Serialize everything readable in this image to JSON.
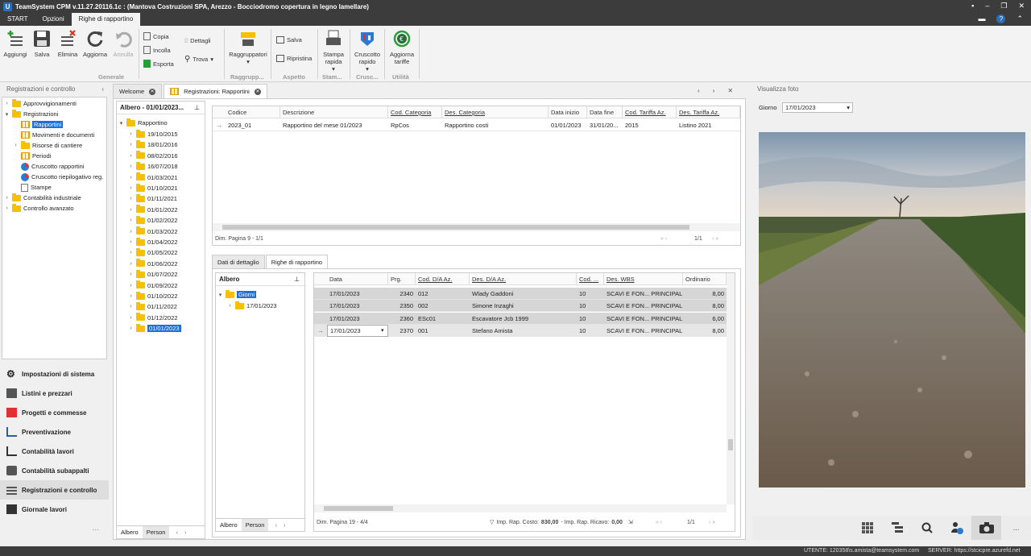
{
  "window": {
    "title": "TeamSystem CPM v.11.27.20116.1c : (Mantova Costruzioni SPA, Arezzo - Bocciodromo copertura in legno lamellare)",
    "logo": "U"
  },
  "menu": {
    "tabs": [
      "START",
      "Opzioni",
      "Righe di rapportino"
    ]
  },
  "ribbon": {
    "buttons": {
      "aggiungi": "Aggiungi",
      "salva": "Salva",
      "elimina": "Elimina",
      "aggiorna": "Aggiorna",
      "annulla": "Annulla",
      "raggruppatori": "Raggruppatori",
      "stampa_rapida": "Stampa rapida",
      "cruscotto_rapido": "Cruscotto rapido",
      "aggiorna_tariffe": "Aggiorna tariffe"
    },
    "small": {
      "copia": "Copia",
      "incolla": "Incolla",
      "esporta": "Esporta",
      "dettagli": "Dettagli",
      "trova": "Trova",
      "salva2": "Salva",
      "ripristina": "Ripristina"
    },
    "groups": {
      "generale": "Generale",
      "raggruppatori": "Raggrupp...",
      "aspetto": "Aspetto",
      "stampa": "Stam...",
      "cruscotti": "Crusc...",
      "utilita": "Utilità"
    }
  },
  "left_panel": {
    "header": "Registrazioni e controllo",
    "tree": [
      "Approvvigionamenti",
      "Registrazioni",
      "Rapportini",
      "Movimenti e documenti",
      "Risorse di cantiere",
      "Periodi",
      "Cruscotto rapportini",
      "Cruscotto riepilogativo reg.",
      "Stampe",
      "Contabilità industriale",
      "Controllo avanzato"
    ],
    "nav": [
      "Impostazioni di sistema",
      "Listini e prezzari",
      "Progetti e commesse",
      "Preventivazione",
      "Contabilità lavori",
      "Contabilità subappalti",
      "Registrazioni e controllo",
      "Giornale lavori"
    ],
    "more": "..."
  },
  "doc_tabs": {
    "welcome": "Welcome",
    "registrazioni": "Registrazioni: Rapportini"
  },
  "albero": {
    "header": "Albero - 01/01/2023...",
    "root": "Rapportino",
    "dates": [
      "19/10/2015",
      "18/01/2016",
      "08/02/2016",
      "16/07/2018",
      "01/03/2021",
      "01/10/2021",
      "01/11/2021",
      "01/01/2022",
      "01/02/2022",
      "01/03/2022",
      "01/04/2022",
      "01/05/2022",
      "01/06/2022",
      "01/07/2022",
      "01/09/2022",
      "01/10/2022",
      "01/11/2022",
      "01/12/2022",
      "01/01/2023"
    ],
    "tabs": [
      "Albero",
      "Person"
    ]
  },
  "top_grid": {
    "columns": [
      "Codice",
      "Descrizione",
      "Cod. Categoria",
      "Des. Categoria",
      "Data inizio",
      "Data fine",
      "Cod. Tariffa Az.",
      "Des. Tariffa Az."
    ],
    "rows": [
      [
        "2023_01",
        "Rapportino del mese 01/2023",
        "RpCos",
        "Rapportino costi",
        "01/01/2023",
        "31/01/20...",
        "2015",
        "Listino 2021"
      ]
    ],
    "pager": "Dim. Pagina 9  - 1/1",
    "page": "1/1"
  },
  "sub_tabs": [
    "Dati di dettaglio",
    "Righe di rapportino"
  ],
  "inner_tree": {
    "header": "Albero",
    "root": "Giorni",
    "child": "17/01/2023",
    "tabs": [
      "Albero",
      "Person"
    ]
  },
  "lines_grid": {
    "columns": [
      "Data",
      "Prg.",
      "Cod. D/A Az.",
      "Des. D/A Az.",
      "Cod. ...",
      "Des. WBS",
      "Ordinario"
    ],
    "rows": [
      [
        "17/01/2023",
        "2340",
        "012",
        "Wlady Gaddoni",
        "10",
        "SCAVI E FON... PRINCIPALE",
        "8,00"
      ],
      [
        "17/01/2023",
        "2350",
        "002",
        "Simone Inzaghi",
        "10",
        "SCAVI E FON... PRINCIPALE",
        "8,00"
      ],
      [
        "17/01/2023",
        "2360",
        "ESc01",
        "Escavatore Jcb 1999",
        "10",
        "SCAVI E FON... PRINCIPALE",
        "6,00"
      ],
      [
        "17/01/2023",
        "2370",
        "001",
        "Stefano Amista",
        "10",
        "SCAVI E FON... PRINCIPALE",
        "8,00"
      ]
    ],
    "pager": "Dim. Pagina 19  - 4/4",
    "footer_costo_label": "Imp. Rap. Costo:",
    "footer_costo": "830,00",
    "footer_ricavo_label": "- Imp. Rap. Ricavo:",
    "footer_ricavo": "0,00",
    "page": "1/1"
  },
  "photo_panel": {
    "header": "Visualizza foto",
    "giorno_label": "Giorno",
    "giorno_value": "17/01/2023"
  },
  "status": {
    "utente": "UTENTE: 120358\\s.amista@teamsystem.com",
    "server": "SERVER: https://stcicpre.azurefd.net"
  },
  "colors": {
    "titlebar": "#3c3c3c",
    "selection": "#1e6fd9",
    "folder": "#f5c000"
  }
}
